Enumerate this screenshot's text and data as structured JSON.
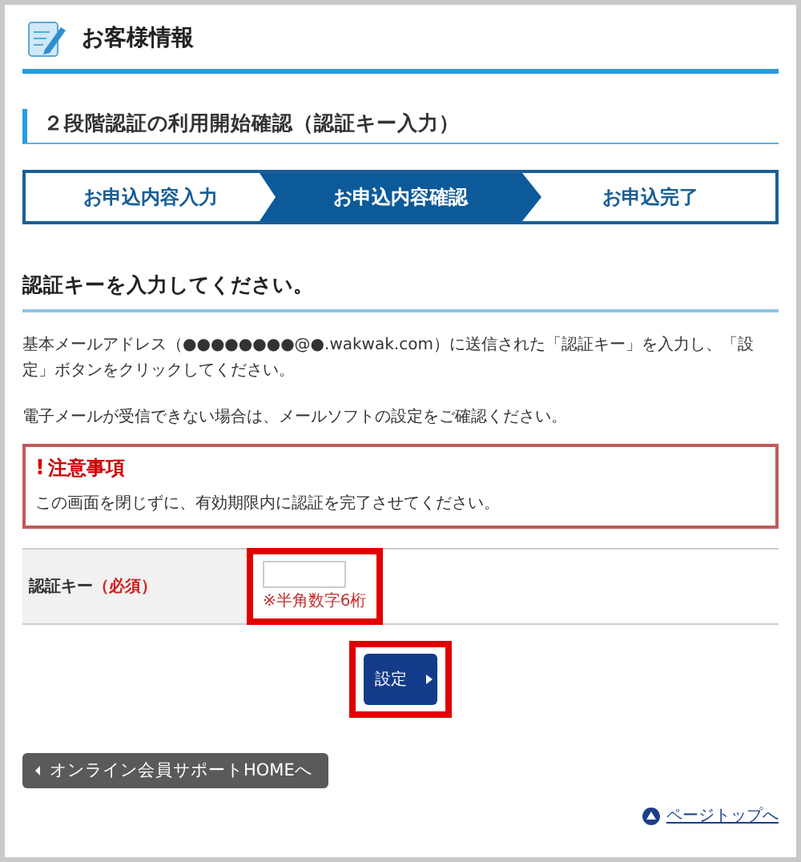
{
  "page_title": "お客様情報",
  "section_title": "２段階認証の利用開始確認（認証キー入力）",
  "steps": [
    {
      "label": "お申込内容入力",
      "selected": false
    },
    {
      "label": "お申込内容確認",
      "selected": true
    },
    {
      "label": "お申込完了",
      "selected": false
    }
  ],
  "form_heading": "認証キーを入力してください。",
  "paragraphs": [
    "基本メールアドレス（●●●●●●●●@●.wakwak.com）に送信された「認証キー」を入力し、「設定」ボタンをクリックしてください。",
    "電子メールが受信できない場合は、メールソフトの設定をご確認ください。"
  ],
  "notice": {
    "icon": "!",
    "title": "注意事項",
    "text": "この画面を閉じずに、有効期限内に認証を完了させてください。"
  },
  "field": {
    "label": "認証キー",
    "required": "（必須）",
    "hint": "※半角数字6桁",
    "highlighted": true
  },
  "submit": {
    "label": "設定",
    "highlighted": true
  },
  "back_link": "オンライン会員サポートHOMEへ",
  "page_top_link": "ページトップへ"
}
